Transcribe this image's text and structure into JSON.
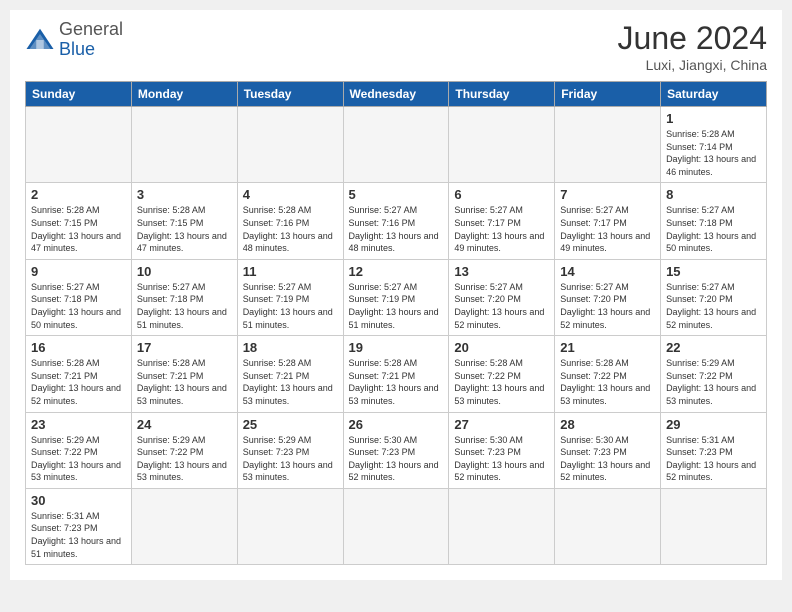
{
  "header": {
    "logo_general": "General",
    "logo_blue": "Blue",
    "month_title": "June 2024",
    "location": "Luxi, Jiangxi, China"
  },
  "weekdays": [
    "Sunday",
    "Monday",
    "Tuesday",
    "Wednesday",
    "Thursday",
    "Friday",
    "Saturday"
  ],
  "weeks": [
    [
      {
        "day": "",
        "info": ""
      },
      {
        "day": "",
        "info": ""
      },
      {
        "day": "",
        "info": ""
      },
      {
        "day": "",
        "info": ""
      },
      {
        "day": "",
        "info": ""
      },
      {
        "day": "",
        "info": ""
      },
      {
        "day": "1",
        "info": "Sunrise: 5:28 AM\nSunset: 7:14 PM\nDaylight: 13 hours and 46 minutes."
      }
    ],
    [
      {
        "day": "2",
        "info": "Sunrise: 5:28 AM\nSunset: 7:15 PM\nDaylight: 13 hours and 47 minutes."
      },
      {
        "day": "3",
        "info": "Sunrise: 5:28 AM\nSunset: 7:15 PM\nDaylight: 13 hours and 47 minutes."
      },
      {
        "day": "4",
        "info": "Sunrise: 5:28 AM\nSunset: 7:16 PM\nDaylight: 13 hours and 48 minutes."
      },
      {
        "day": "5",
        "info": "Sunrise: 5:27 AM\nSunset: 7:16 PM\nDaylight: 13 hours and 48 minutes."
      },
      {
        "day": "6",
        "info": "Sunrise: 5:27 AM\nSunset: 7:17 PM\nDaylight: 13 hours and 49 minutes."
      },
      {
        "day": "7",
        "info": "Sunrise: 5:27 AM\nSunset: 7:17 PM\nDaylight: 13 hours and 49 minutes."
      },
      {
        "day": "8",
        "info": "Sunrise: 5:27 AM\nSunset: 7:18 PM\nDaylight: 13 hours and 50 minutes."
      }
    ],
    [
      {
        "day": "9",
        "info": "Sunrise: 5:27 AM\nSunset: 7:18 PM\nDaylight: 13 hours and 50 minutes."
      },
      {
        "day": "10",
        "info": "Sunrise: 5:27 AM\nSunset: 7:18 PM\nDaylight: 13 hours and 51 minutes."
      },
      {
        "day": "11",
        "info": "Sunrise: 5:27 AM\nSunset: 7:19 PM\nDaylight: 13 hours and 51 minutes."
      },
      {
        "day": "12",
        "info": "Sunrise: 5:27 AM\nSunset: 7:19 PM\nDaylight: 13 hours and 51 minutes."
      },
      {
        "day": "13",
        "info": "Sunrise: 5:27 AM\nSunset: 7:20 PM\nDaylight: 13 hours and 52 minutes."
      },
      {
        "day": "14",
        "info": "Sunrise: 5:27 AM\nSunset: 7:20 PM\nDaylight: 13 hours and 52 minutes."
      },
      {
        "day": "15",
        "info": "Sunrise: 5:27 AM\nSunset: 7:20 PM\nDaylight: 13 hours and 52 minutes."
      }
    ],
    [
      {
        "day": "16",
        "info": "Sunrise: 5:28 AM\nSunset: 7:21 PM\nDaylight: 13 hours and 52 minutes."
      },
      {
        "day": "17",
        "info": "Sunrise: 5:28 AM\nSunset: 7:21 PM\nDaylight: 13 hours and 53 minutes."
      },
      {
        "day": "18",
        "info": "Sunrise: 5:28 AM\nSunset: 7:21 PM\nDaylight: 13 hours and 53 minutes."
      },
      {
        "day": "19",
        "info": "Sunrise: 5:28 AM\nSunset: 7:21 PM\nDaylight: 13 hours and 53 minutes."
      },
      {
        "day": "20",
        "info": "Sunrise: 5:28 AM\nSunset: 7:22 PM\nDaylight: 13 hours and 53 minutes."
      },
      {
        "day": "21",
        "info": "Sunrise: 5:28 AM\nSunset: 7:22 PM\nDaylight: 13 hours and 53 minutes."
      },
      {
        "day": "22",
        "info": "Sunrise: 5:29 AM\nSunset: 7:22 PM\nDaylight: 13 hours and 53 minutes."
      }
    ],
    [
      {
        "day": "23",
        "info": "Sunrise: 5:29 AM\nSunset: 7:22 PM\nDaylight: 13 hours and 53 minutes."
      },
      {
        "day": "24",
        "info": "Sunrise: 5:29 AM\nSunset: 7:22 PM\nDaylight: 13 hours and 53 minutes."
      },
      {
        "day": "25",
        "info": "Sunrise: 5:29 AM\nSunset: 7:23 PM\nDaylight: 13 hours and 53 minutes."
      },
      {
        "day": "26",
        "info": "Sunrise: 5:30 AM\nSunset: 7:23 PM\nDaylight: 13 hours and 52 minutes."
      },
      {
        "day": "27",
        "info": "Sunrise: 5:30 AM\nSunset: 7:23 PM\nDaylight: 13 hours and 52 minutes."
      },
      {
        "day": "28",
        "info": "Sunrise: 5:30 AM\nSunset: 7:23 PM\nDaylight: 13 hours and 52 minutes."
      },
      {
        "day": "29",
        "info": "Sunrise: 5:31 AM\nSunset: 7:23 PM\nDaylight: 13 hours and 52 minutes."
      }
    ],
    [
      {
        "day": "30",
        "info": "Sunrise: 5:31 AM\nSunset: 7:23 PM\nDaylight: 13 hours and 51 minutes."
      },
      {
        "day": "",
        "info": ""
      },
      {
        "day": "",
        "info": ""
      },
      {
        "day": "",
        "info": ""
      },
      {
        "day": "",
        "info": ""
      },
      {
        "day": "",
        "info": ""
      },
      {
        "day": "",
        "info": ""
      }
    ]
  ]
}
